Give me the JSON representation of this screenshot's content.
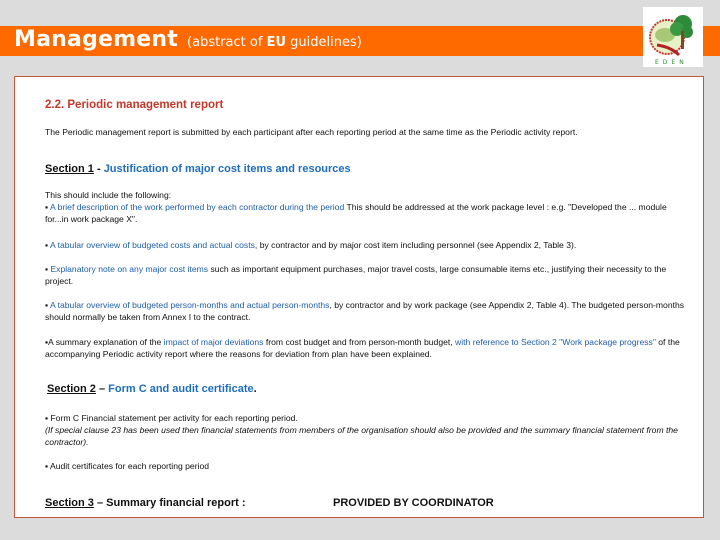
{
  "header": {
    "title": "Management",
    "subtitle_prefix": "(abstract of ",
    "subtitle_bold": "EU",
    "subtitle_suffix": " guidelines)",
    "band_color": "#ff6a00",
    "logo": {
      "name": "eden-logo",
      "text": "EDEN"
    }
  },
  "content": {
    "heading": "2.2. Periodic management report",
    "intro": "The Periodic management report is submitted by each participant after each reporting period at the same time as the Periodic activity report.",
    "section1": {
      "label": "Section 1",
      "sep": " - ",
      "title": "Justification of major cost items and resources",
      "lead": "This should include the following:",
      "bullets": [
        {
          "blue": "A brief description of the work performed by each contractor during the period",
          "rest": " This should be addressed at the work package level : e.g. \"Developed the ... module for...in work package X\"."
        },
        {
          "blue": "A tabular overview of budgeted costs and actual costs",
          "rest": ", by contractor and by major cost item including personnel (see Appendix 2, Table 3)."
        },
        {
          "blue": "Explanatory note on any major cost items",
          "rest": " such as important equipment purchases, major travel costs, large consumable items etc., justifying their necessity to the project."
        },
        {
          "blue": "A tabular overview of budgeted person-months and actual person-months",
          "rest": ", by contractor and by work package (see Appendix 2, Table 4). The budgeted person-months should normally be taken from Annex I to the contract."
        },
        {
          "pre": "A summary explanation of the ",
          "blue": "impact of major deviations",
          "mid": " from cost budget and from person-month budget, ",
          "blue2": "with reference to Section 2 \"Work package progress\"",
          "rest": " of the accompanying Periodic activity report where the reasons for deviation from plan have been explained."
        }
      ]
    },
    "section2": {
      "label": "Section 2",
      "sep": " – ",
      "title": "Form C and audit certificate",
      "end": ".",
      "bullet1": "Form C Financial statement per activity for each reporting period.",
      "note": "(If special clause 23 has been used then financial statements from members of the organisation should also be provided and the summary financial statement from the contractor).",
      "bullet2": "Audit certificates for each reporting period"
    },
    "section3": {
      "label": "Section 3",
      "sep": " – ",
      "title": "Summary financial report :",
      "provided": "PROVIDED BY COORDINATOR"
    }
  }
}
